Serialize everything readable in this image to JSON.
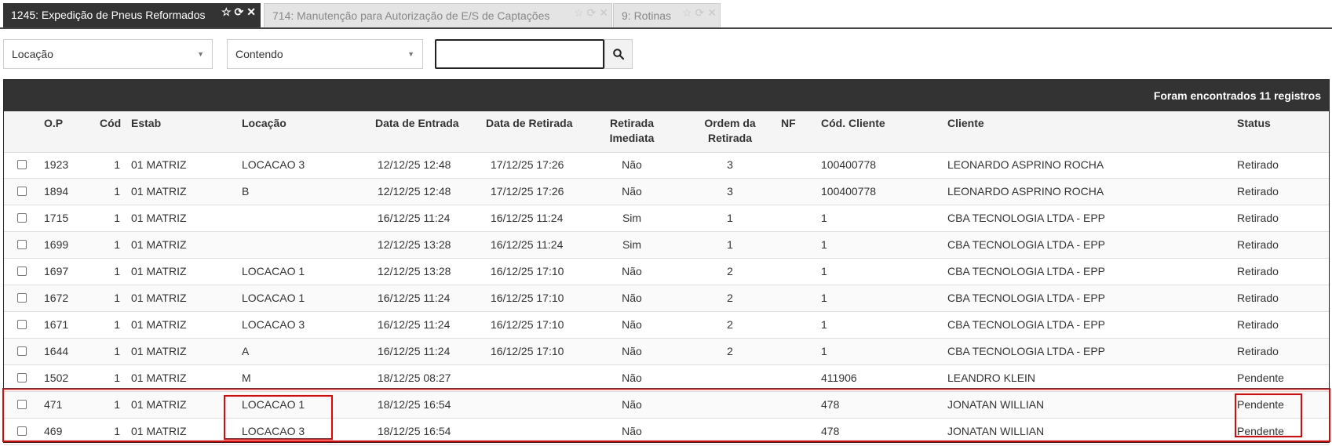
{
  "tabs": [
    {
      "label": "1245: Expedição de Pneus Reformados",
      "active": true
    },
    {
      "label": "714: Manutenção para Autorização de E/S de Captações",
      "active": false
    },
    {
      "label": "9: Rotinas",
      "active": false
    }
  ],
  "filters": {
    "field": "Locação",
    "operator": "Contendo",
    "value": ""
  },
  "grid": {
    "count_text": "Foram encontrados 11 registros",
    "columns": {
      "op": "O.P",
      "cod": "Cód",
      "estab": "Estab",
      "locacao": "Locação",
      "data_entrada": "Data de Entrada",
      "data_retirada": "Data de Retirada",
      "retirada_imediata": [
        "Retirada",
        "Imediata"
      ],
      "ordem_retirada": [
        "Ordem da",
        "Retirada"
      ],
      "nf": "NF",
      "cod_cliente": "Cód. Cliente",
      "cliente": "Cliente",
      "status": "Status"
    },
    "rows": [
      {
        "op": "1923",
        "cod": "1",
        "estab": "01 MATRIZ",
        "locacao": "LOCACAO 3",
        "data_entrada": "12/12/25 12:48",
        "data_retirada": "17/12/25 17:26",
        "retirada_imediata": "Não",
        "ordem": "3",
        "nf": "",
        "cod_cliente": "100400778",
        "cliente": "LEONARDO ASPRINO ROCHA",
        "status": "Retirado"
      },
      {
        "op": "1894",
        "cod": "1",
        "estab": "01 MATRIZ",
        "locacao": "B",
        "data_entrada": "12/12/25 12:48",
        "data_retirada": "17/12/25 17:26",
        "retirada_imediata": "Não",
        "ordem": "3",
        "nf": "",
        "cod_cliente": "100400778",
        "cliente": "LEONARDO ASPRINO ROCHA",
        "status": "Retirado"
      },
      {
        "op": "1715",
        "cod": "1",
        "estab": "01 MATRIZ",
        "locacao": "",
        "data_entrada": "16/12/25 11:24",
        "data_retirada": "16/12/25 11:24",
        "retirada_imediata": "Sim",
        "ordem": "1",
        "nf": "",
        "cod_cliente": "1",
        "cliente": "CBA TECNOLOGIA LTDA - EPP",
        "status": "Retirado"
      },
      {
        "op": "1699",
        "cod": "1",
        "estab": "01 MATRIZ",
        "locacao": "",
        "data_entrada": "12/12/25 13:28",
        "data_retirada": "16/12/25 11:24",
        "retirada_imediata": "Sim",
        "ordem": "1",
        "nf": "",
        "cod_cliente": "1",
        "cliente": "CBA TECNOLOGIA LTDA - EPP",
        "status": "Retirado"
      },
      {
        "op": "1697",
        "cod": "1",
        "estab": "01 MATRIZ",
        "locacao": "LOCACAO 1",
        "data_entrada": "12/12/25 13:28",
        "data_retirada": "16/12/25 17:10",
        "retirada_imediata": "Não",
        "ordem": "2",
        "nf": "",
        "cod_cliente": "1",
        "cliente": "CBA TECNOLOGIA LTDA - EPP",
        "status": "Retirado"
      },
      {
        "op": "1672",
        "cod": "1",
        "estab": "01 MATRIZ",
        "locacao": "LOCACAO 1",
        "data_entrada": "16/12/25 11:24",
        "data_retirada": "16/12/25 17:10",
        "retirada_imediata": "Não",
        "ordem": "2",
        "nf": "",
        "cod_cliente": "1",
        "cliente": "CBA TECNOLOGIA LTDA - EPP",
        "status": "Retirado"
      },
      {
        "op": "1671",
        "cod": "1",
        "estab": "01 MATRIZ",
        "locacao": "LOCACAO 3",
        "data_entrada": "16/12/25 11:24",
        "data_retirada": "16/12/25 17:10",
        "retirada_imediata": "Não",
        "ordem": "2",
        "nf": "",
        "cod_cliente": "1",
        "cliente": "CBA TECNOLOGIA LTDA - EPP",
        "status": "Retirado"
      },
      {
        "op": "1644",
        "cod": "1",
        "estab": "01 MATRIZ",
        "locacao": "A",
        "data_entrada": "16/12/25 11:24",
        "data_retirada": "16/12/25 17:10",
        "retirada_imediata": "Não",
        "ordem": "2",
        "nf": "",
        "cod_cliente": "1",
        "cliente": "CBA TECNOLOGIA LTDA - EPP",
        "status": "Retirado"
      },
      {
        "op": "1502",
        "cod": "1",
        "estab": "01 MATRIZ",
        "locacao": "M",
        "data_entrada": "18/12/25 08:27",
        "data_retirada": "",
        "retirada_imediata": "Não",
        "ordem": "",
        "nf": "",
        "cod_cliente": "411906",
        "cliente": "LEANDRO KLEIN",
        "status": "Pendente"
      },
      {
        "op": "471",
        "cod": "1",
        "estab": "01 MATRIZ",
        "locacao": "LOCACAO 1",
        "data_entrada": "18/12/25 16:54",
        "data_retirada": "",
        "retirada_imediata": "Não",
        "ordem": "",
        "nf": "",
        "cod_cliente": "478",
        "cliente": "JONATAN WILLIAN",
        "status": "Pendente"
      },
      {
        "op": "469",
        "cod": "1",
        "estab": "01 MATRIZ",
        "locacao": "LOCACAO 3",
        "data_entrada": "18/12/25 16:54",
        "data_retirada": "",
        "retirada_imediata": "Não",
        "ordem": "",
        "nf": "",
        "cod_cliente": "478",
        "cliente": "JONATAN WILLIAN",
        "status": "Pendente"
      }
    ]
  },
  "colors": {
    "header_bg": "#333333",
    "highlight": "#e00000"
  }
}
